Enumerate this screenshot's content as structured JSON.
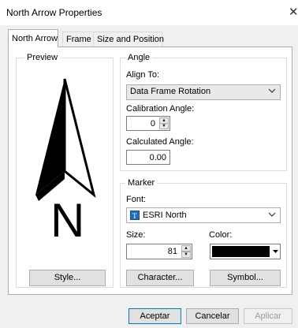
{
  "window": {
    "title": "North Arrow Properties",
    "close_glyph": "✕"
  },
  "tabs": [
    {
      "label": "North Arrow"
    },
    {
      "label": "Frame"
    },
    {
      "label": "Size and Position"
    }
  ],
  "preview": {
    "legend": "Preview",
    "letter": "N",
    "style_button": "Style..."
  },
  "angle": {
    "legend": "Angle",
    "align_label": "Align To:",
    "align_value": "Data Frame Rotation",
    "calibration_label": "Calibration Angle:",
    "calibration_value": "0",
    "calculated_label": "Calculated Angle:",
    "calculated_value": "0.00"
  },
  "marker": {
    "legend": "Marker",
    "font_label": "Font:",
    "font_value": "ESRI North",
    "size_label": "Size:",
    "size_value": "81",
    "color_label": "Color:",
    "color_value": "#000000",
    "character_button": "Character...",
    "symbol_button": "Symbol..."
  },
  "footer": {
    "ok": "Aceptar",
    "cancel": "Cancelar",
    "apply": "Aplicar"
  }
}
